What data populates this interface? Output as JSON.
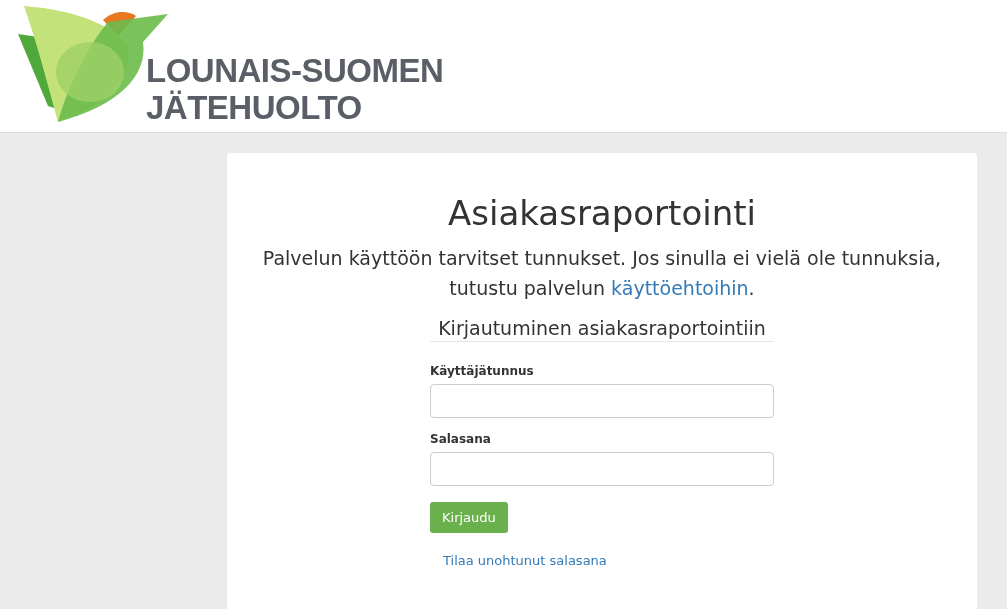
{
  "logo": {
    "lines": [
      "LOUNAIS-SUOMEN",
      "JÄTEHUOLTO"
    ]
  },
  "title": "Asiakasraportointi",
  "intro": {
    "text": "Palvelun käyttöön tarvitset tunnukset. Jos sinulla ei vielä ole tunnuksia, tutustu palvelun ",
    "link": "käyttöehtoihin",
    "after": "."
  },
  "form": {
    "legend": "Kirjautuminen asiakasraportointiin",
    "fields": [
      {
        "label": "Käyttäjätunnus"
      },
      {
        "label": "Salasana"
      }
    ],
    "submit": "Kirjaudu",
    "forgot_link": "Tilaa unohtunut salasana"
  }
}
